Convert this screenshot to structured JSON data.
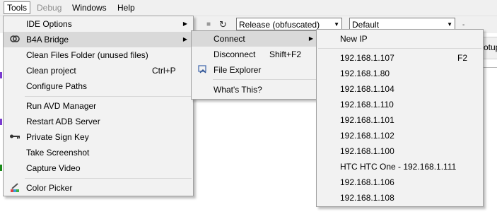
{
  "menubar": {
    "items": [
      {
        "label": "Tools"
      },
      {
        "label": "Debug"
      },
      {
        "label": "Windows"
      },
      {
        "label": "Help"
      }
    ]
  },
  "toolbar": {
    "build_config": "Release (obfuscated)",
    "device_config": "Default"
  },
  "background": {
    "tab_fragment": "otup"
  },
  "tools_menu": {
    "items": [
      {
        "label": "IDE Options",
        "has_submenu": true
      },
      {
        "label": "B4A Bridge",
        "has_submenu": true
      },
      {
        "label": "Clean Files Folder (unused files)"
      },
      {
        "label": "Clean project",
        "shortcut": "Ctrl+P"
      },
      {
        "label": "Configure Paths"
      },
      {
        "label": "Run AVD Manager"
      },
      {
        "label": "Restart ADB Server"
      },
      {
        "label": "Private Sign Key"
      },
      {
        "label": "Take Screenshot"
      },
      {
        "label": "Capture Video"
      },
      {
        "label": "Color Picker"
      }
    ]
  },
  "bridge_menu": {
    "items": [
      {
        "label": "Connect",
        "has_submenu": true
      },
      {
        "label": "Disconnect",
        "shortcut": "Shift+F2"
      },
      {
        "label": "File Explorer"
      },
      {
        "label": "What's This?"
      }
    ]
  },
  "connect_menu": {
    "items": [
      {
        "label": "New IP"
      },
      {
        "label": "192.168.1.107",
        "shortcut": "F2"
      },
      {
        "label": "192.168.1.80"
      },
      {
        "label": "192.168.1.104"
      },
      {
        "label": "192.168.1.110"
      },
      {
        "label": "192.168.1.101"
      },
      {
        "label": "192.168.1.102"
      },
      {
        "label": "192.168.1.100"
      },
      {
        "label": "HTC HTC One - 192.168.1.111"
      },
      {
        "label": "192.168.1.106"
      },
      {
        "label": "192.168.1.108"
      }
    ]
  }
}
